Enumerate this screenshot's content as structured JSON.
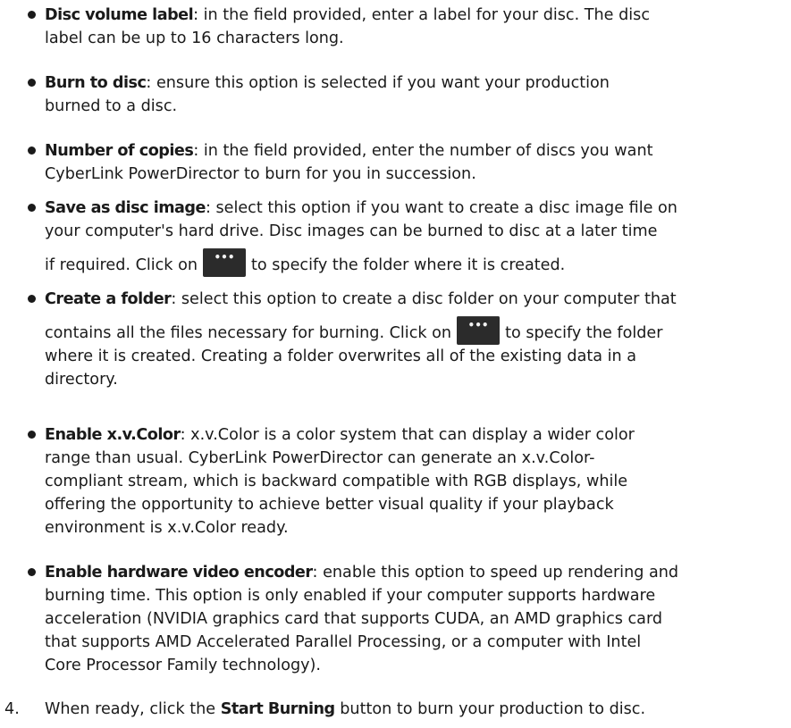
{
  "bullets": [
    {
      "term": "Disc volume label",
      "rest_lines": [
        ": in the field provided, enter a label for your disc. The disc",
        "label can be up to 16 characters long."
      ]
    },
    {
      "term": "Burn to disc",
      "rest_lines": [
        ": ensure this option is selected if you want your production",
        "burned to a disc."
      ]
    },
    {
      "term": "Number of copies",
      "rest_lines": [
        ": in the field provided, enter the number of discs you want",
        "CyberLink PowerDirector to burn for you in succession."
      ]
    },
    {
      "term": "Save as disc image",
      "rest_lines": [
        ": select this option if you want to create a disc image file on",
        "your computer's hard drive. Disc images can be burned to disc at a later time",
        "if required. Click on",
        "to specify the folder where it is created."
      ]
    },
    {
      "term": "Create a folder",
      "rest_lines": [
        ": select this option to create a disc folder on your computer that",
        "contains all the files necessary for burning. Click on",
        "to specify the folder",
        "where it is created. Creating a folder overwrites all of the existing data in a",
        "directory."
      ]
    },
    {
      "term": "Enable x.v.Color",
      "rest_lines": [
        ": x.v.Color is a color system that can display a wider color",
        "range than usual. CyberLink PowerDirector can generate an x.v.Color-",
        "compliant stream, which is backward compatible with RGB displays, while",
        "offering the opportunity to achieve better visual quality if your playback",
        "environment is x.v.Color ready."
      ]
    },
    {
      "term": "Enable hardware video encoder",
      "rest_lines": [
        ": enable this option to speed up rendering and",
        "burning time. This option is only enabled if your computer supports hardware",
        "acceleration (NVIDIA graphics card that supports CUDA, an AMD graphics card",
        "that supports AMD Accelerated Parallel Processing, or a computer with Intel",
        "Core Processor Family technology)."
      ]
    }
  ],
  "browse_button_glyph": "•••",
  "step": {
    "number": "4.",
    "text_before": "When ready, click the ",
    "button_name": "Start Burning",
    "text_after": " button to burn your production to disc."
  }
}
